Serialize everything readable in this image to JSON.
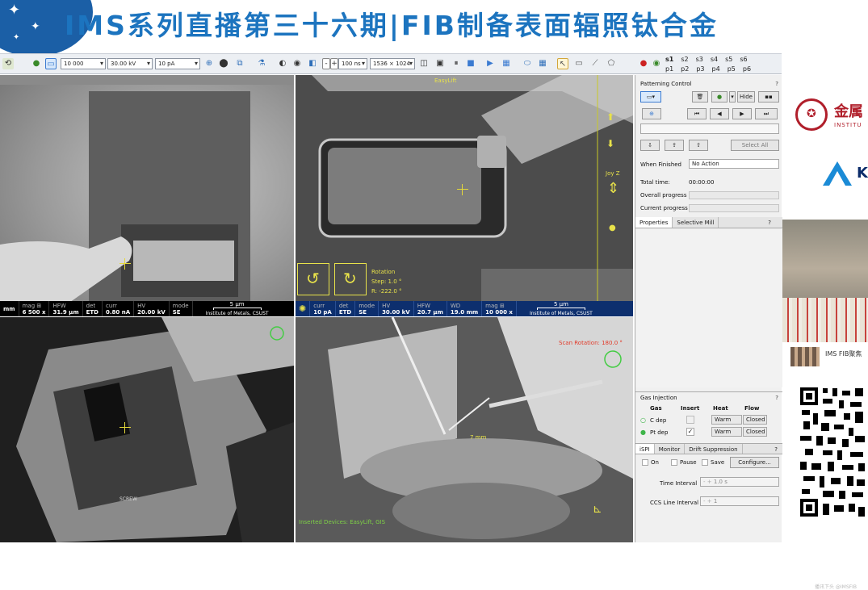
{
  "banner": {
    "title": "IMS系列直播第三十六期|FIB制备表面辐照钛合金"
  },
  "toolbar": {
    "hfw": "10 000",
    "hv": "30.00 kV",
    "curr": "10 pA",
    "dwell": "100 ns",
    "res": "1536 × 1024",
    "presets_row1": [
      "s1",
      "s2",
      "s3",
      "s4",
      "s5",
      "s6"
    ],
    "presets_row2": [
      "p1",
      "p2",
      "p3",
      "p4",
      "p5",
      "p6"
    ]
  },
  "quad1": {
    "databar": [
      {
        "k": "",
        "v": "mm"
      },
      {
        "k": "mag ⊞",
        "v": "6 500 x"
      },
      {
        "k": "HFW",
        "v": "31.9 μm"
      },
      {
        "k": "det",
        "v": "ETD"
      },
      {
        "k": "curr",
        "v": "0.80 nA"
      },
      {
        "k": "HV",
        "v": "20.00 kV"
      },
      {
        "k": "mode",
        "v": "SE"
      }
    ],
    "scale": "5 μm",
    "institute": "Institute of Metals, CSUST"
  },
  "quad2": {
    "header": "EasyLift",
    "rotation_label": "Rotation",
    "step": "Step: 1.0 °",
    "r_value": "R: -222.0 °",
    "joy": "Joy Z",
    "databar": [
      {
        "k": "curr",
        "v": "10 pA"
      },
      {
        "k": "det",
        "v": "ETD"
      },
      {
        "k": "mode",
        "v": "SE"
      },
      {
        "k": "HV",
        "v": "30.00 kV"
      },
      {
        "k": "HFW",
        "v": "20.7 μm"
      },
      {
        "k": "WD",
        "v": "19.0 mm"
      },
      {
        "k": "mag ⊞",
        "v": "10 000 x"
      }
    ],
    "scale": "5 μm",
    "institute": "Institute of Metals, CSUST"
  },
  "quad3": {
    "label": "SCREW"
  },
  "quad4": {
    "scan_rotation": "Scan Rotation: 180.0 °",
    "distance": "7 mm",
    "footer": "Inserted Devices: EasyLift, GIS"
  },
  "patterning": {
    "title": "Patterning Control",
    "hide": "Hide",
    "select_all": "Select All",
    "when_finished_label": "When Finished",
    "when_finished_value": "No Action",
    "total_time_label": "Total time:",
    "total_time_value": "00:00:00",
    "overall_progress": "Overall progress",
    "overall_progress_fraction": 0,
    "current_progress": "Current progress",
    "current_progress_fraction": 0
  },
  "properties": {
    "tabs": [
      "Properties",
      "Selective Mill"
    ]
  },
  "gas": {
    "title": "Gas Injection",
    "headers": [
      "Gas",
      "Insert",
      "Heat",
      "Flow"
    ],
    "rows": [
      {
        "gas": "C dep",
        "insert": false,
        "heat": "Warm",
        "flow": "Closed"
      },
      {
        "gas": "Pt dep",
        "insert": true,
        "heat": "Warm",
        "flow": "Closed"
      }
    ]
  },
  "ispi": {
    "tabs": [
      "iSPI",
      "Monitor",
      "Drift Suppression"
    ],
    "on": "On",
    "pause": "Pause",
    "save": "Save",
    "configure": "Configure...",
    "time_interval_label": "Time Interval",
    "time_interval_value": "1.0 s",
    "ccs_label": "CCS Line Interval",
    "ccs_value": "1"
  },
  "side": {
    "logo1_text": "金属",
    "logo1_sub": "INSTITU",
    "logo2_text": "K",
    "group_label": "IMS FIB聚焦",
    "bottom_text": "播讯下头 @IMSFIB"
  }
}
